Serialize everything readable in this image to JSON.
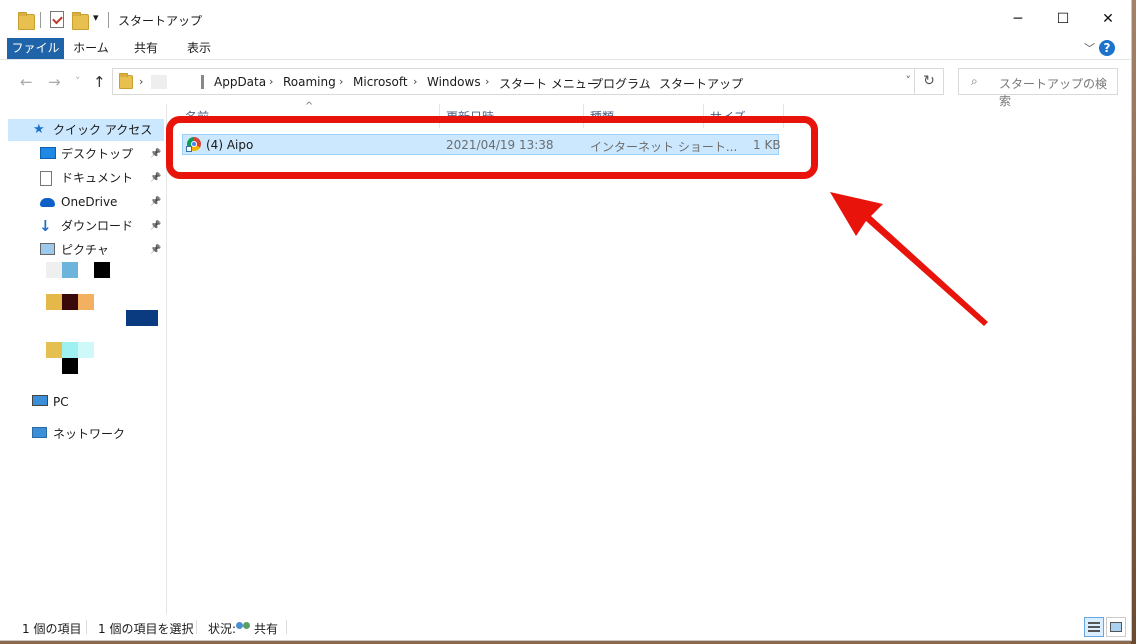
{
  "titlebar": {
    "title": "スタートアップ",
    "qa_dropdown": "▾"
  },
  "window_controls": {
    "minimize": "─",
    "maximize": "☐",
    "close": "✕"
  },
  "ribbon": {
    "tabs": [
      {
        "label": "ファイル"
      },
      {
        "label": "ホーム"
      },
      {
        "label": "共有"
      },
      {
        "label": "表示"
      }
    ],
    "expand_glyph": "﹀",
    "help_glyph": "?"
  },
  "nav": {
    "back": "←",
    "forward": "→",
    "recent": "˅",
    "up": "↑"
  },
  "address": {
    "crumbs": [
      "AppData",
      "Roaming",
      "Microsoft",
      "Windows",
      "スタート メニュー",
      "プログラム",
      "スタートアップ"
    ],
    "chevron": "›",
    "dropdown": "˅",
    "refresh": "↻"
  },
  "search": {
    "placeholder": "スタートアップの検索",
    "icon": "⌕"
  },
  "navpane": {
    "quick_access": {
      "label": "クイック アクセス",
      "icon": "star-icon"
    },
    "items": [
      {
        "label": "デスクトップ",
        "icon": "desktop-icon",
        "pinned": true
      },
      {
        "label": "ドキュメント",
        "icon": "document-icon",
        "pinned": true
      },
      {
        "label": "OneDrive",
        "icon": "cloud-icon",
        "pinned": true
      },
      {
        "label": "ダウンロード",
        "icon": "download-icon",
        "pinned": true
      },
      {
        "label": "ピクチャ",
        "icon": "picture-icon",
        "pinned": true
      }
    ],
    "pin_glyph": "📌",
    "pc": {
      "label": "PC",
      "icon": "computer-icon"
    },
    "network": {
      "label": "ネットワーク",
      "icon": "network-icon"
    }
  },
  "columns": {
    "name": "名前",
    "date": "更新日時",
    "type": "種類",
    "size": "サイズ",
    "sort_glyph": "^"
  },
  "files": [
    {
      "name": "(4) Aipo",
      "date": "2021/04/19 13:38",
      "type": "インターネット ショート...",
      "size": "1 KB",
      "icon": "chrome-shortcut-icon",
      "selected": true
    }
  ],
  "status": {
    "item_count": "1 個の項目",
    "selected": "1 個の項目を選択",
    "state_label": "状況:",
    "state_value": "共有"
  },
  "colors": {
    "accent": "#1f63a8",
    "selection": "#cce8ff",
    "annotation": "#e8140c"
  }
}
